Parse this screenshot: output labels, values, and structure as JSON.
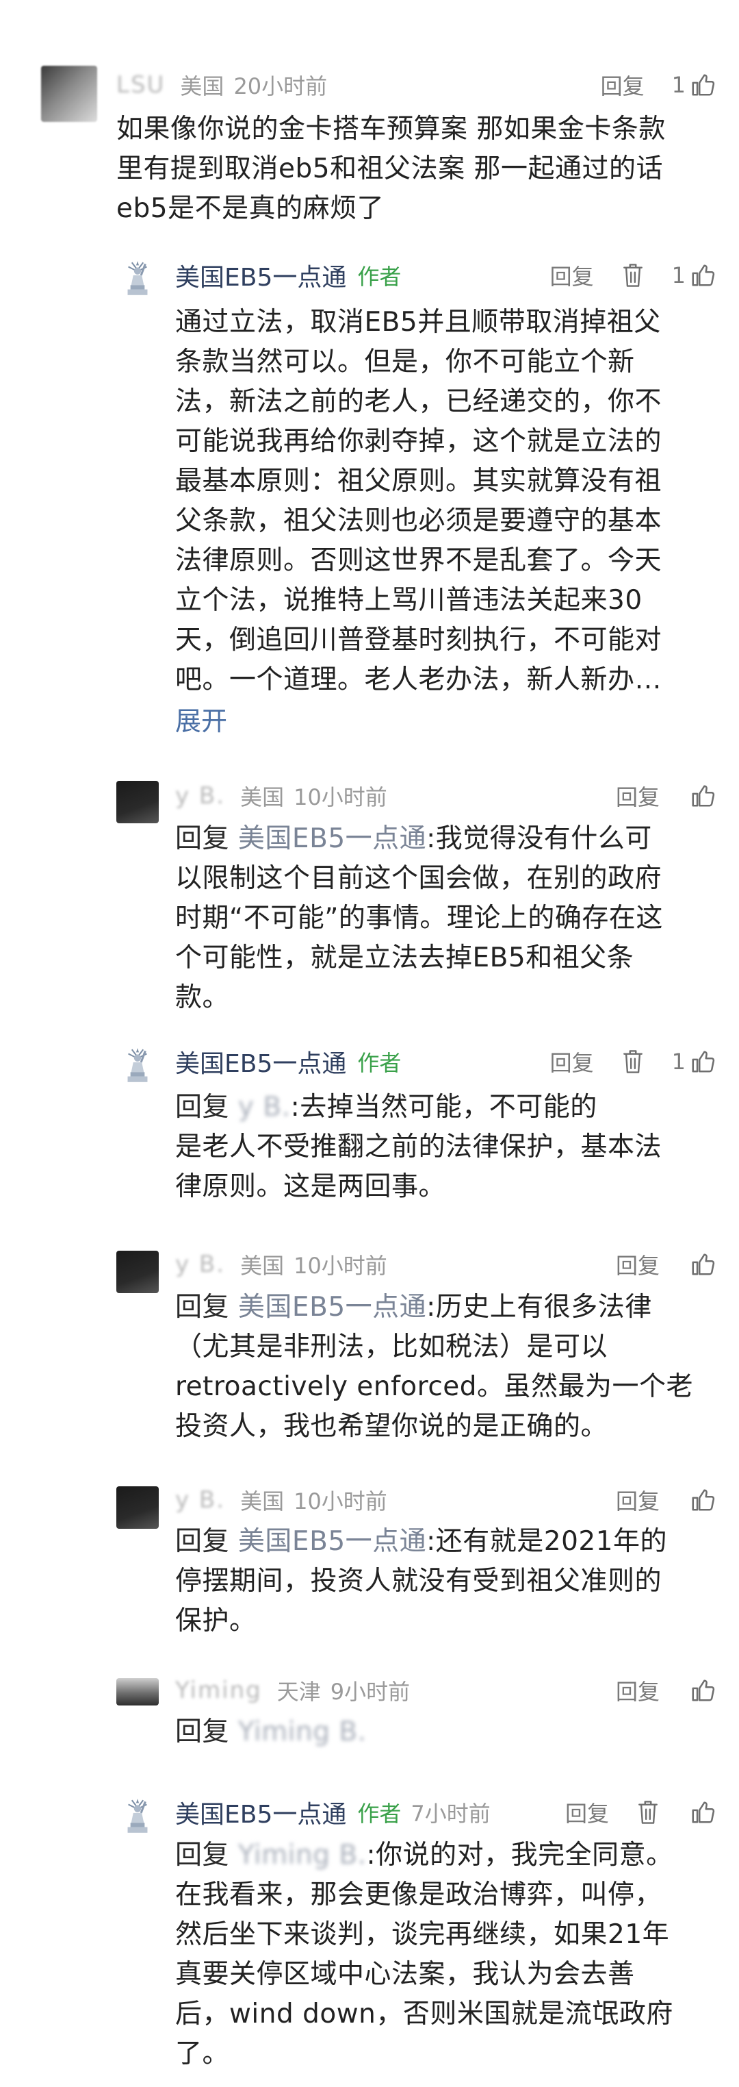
{
  "comments": [
    {
      "name": "LSU",
      "location": "美国",
      "time": "20小时前",
      "reply_label": "回复",
      "likes": "1",
      "lines": [
        "如果像你说的金卡搭车预算案 那如果金卡条款",
        "里有提到取消eb5和祖父法案 那一起通过的话",
        "eb5是不是真的麻烦了"
      ]
    },
    {
      "name": "美国EB5一点通",
      "author_tag": "作者",
      "reply_label": "回复",
      "likes": "1",
      "lines": [
        "通过立法，取消EB5并且顺带取消掉祖父",
        "条款当然可以。但是，你不可能立个新",
        "法，新法之前的老人，已经递交的，你不",
        "可能说我再给你剥夺掉，这个就是立法的",
        "最基本原则：祖父原则。其实就算没有祖",
        "父条款，祖父法则也必须是要遵守的基本",
        "法律原则。否则这世界不是乱套了。今天",
        "立个法，说推特上骂川普违法关起来30",
        "天，倒追回川普登基时刻执行，不可能对",
        "吧。一个道理。老人老办法，新人新办…"
      ],
      "expand_label": "展开"
    },
    {
      "name": "y B.",
      "location": "美国",
      "time": "10小时前",
      "reply_label": "回复",
      "reply_prefix": "回复",
      "reply_target": "美国EB5一点通",
      "first_rest": ":我觉得没有什么可",
      "lines": [
        "以限制这个目前这个国会做，在别的政府",
        "时期“不可能”的事情。理论上的确存在这",
        "个可能性，就是立法去掉EB5和祖父条",
        "款。"
      ]
    },
    {
      "name": "美国EB5一点通",
      "author_tag": "作者",
      "reply_label": "回复",
      "likes": "1",
      "reply_prefix": "回复",
      "reply_target": "y B.",
      "first_rest": ":去掉当然可能，不可能的",
      "lines": [
        "是老人不受推翻之前的法律保护，基本法",
        "律原则。这是两回事。"
      ]
    },
    {
      "name": "y B.",
      "location": "美国",
      "time": "10小时前",
      "reply_label": "回复",
      "reply_prefix": "回复",
      "reply_target": "美国EB5一点通",
      "first_rest": ":历史上有很多法律",
      "lines": [
        "（尤其是非刑法，比如税法）是可以",
        "retroactively enforced。虽然最为一个老",
        "投资人，我也希望你说的是正确的。"
      ]
    },
    {
      "name": "y B.",
      "location": "美国",
      "time": "10小时前",
      "reply_label": "回复",
      "reply_prefix": "回复",
      "reply_target": "美国EB5一点通",
      "first_rest": ":还有就是2021年的",
      "lines": [
        "停摆期间，投资人就没有受到祖父准则的",
        "保护。"
      ]
    },
    {
      "name": "Yiming",
      "location": "天津",
      "time": "9小时前",
      "reply_label": "回复",
      "reply_prefix": "回复",
      "reply_target": "Yiming B.",
      "first_rest": ""
    },
    {
      "name": "美国EB5一点通",
      "author_tag": "作者",
      "time": "7小时前",
      "reply_label": "回复",
      "reply_prefix": "回复",
      "reply_target": "Yiming B.",
      "first_rest": ":你说的对，我完全同意。",
      "lines": [
        "在我看来，那会更像是政治博弈，叫停，",
        "然后坐下来谈判，谈完再继续，如果21年",
        "真要关停区域中心法案，我认为会去善",
        "后，wind down，否则米国就是流氓政府",
        "了。"
      ]
    }
  ],
  "icons": {
    "trash": "trash-icon",
    "thumb": "thumbs-up-icon",
    "statue_avatar": "statue-of-liberty-avatar"
  },
  "colors": {
    "author_tag": "#3aa14a",
    "reply_target": "#7a8496",
    "expand_link": "#4a6fa5",
    "meta_gray": "#9a9a9a"
  }
}
